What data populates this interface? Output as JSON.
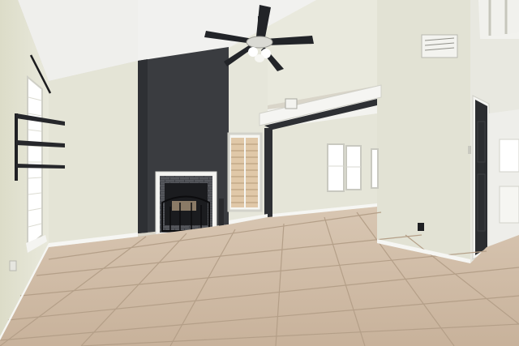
{
  "scene": {
    "type": "photo",
    "room": "living-room",
    "colors": {
      "ceiling": "#efefec",
      "wall": "#e4e4d6",
      "wall_shade": "#d6d6c6",
      "floor": "#cbb59e",
      "grout": "#b49f88",
      "fireplace_column": "#3a3c40",
      "trim": "#f4f4f1",
      "door": "#2b2d30",
      "fan": "#222428"
    },
    "icons": [
      "ceiling-fan-icon",
      "fireplace-icon",
      "window-icon",
      "door-icon",
      "wall-shelf-icon",
      "vent-icon"
    ]
  }
}
